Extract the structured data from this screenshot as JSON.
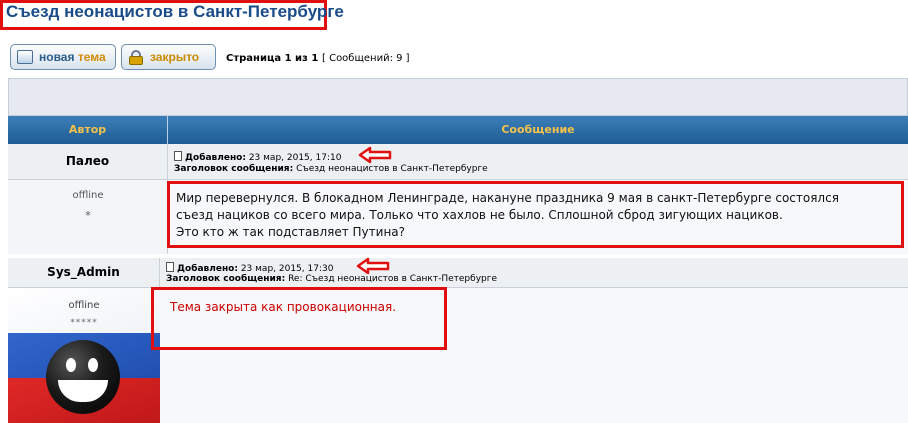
{
  "topic": {
    "title": "Съезд неонацистов в Санкт-Петербурге"
  },
  "toolbar": {
    "new_topic_part1": "новая",
    "new_topic_part2": "тема",
    "locked_label": "закрыто",
    "page_info": "Страница 1 из 1",
    "message_count": "[ Сообщений: 9 ]"
  },
  "table_header": {
    "author": "Автор",
    "message": "Сообщение"
  },
  "posts": [
    {
      "author": "Палео",
      "status": "offline",
      "rank": "*",
      "posted_label": "Добавлено:",
      "posted_date": "23 мар, 2015, 17:10",
      "subject_label": "Заголовок сообщения:",
      "subject": "Съезд неонацистов в Санкт-Петербурге",
      "text_lines": [
        "Мир перевернулся. В блокадном Ленинграде, накануне праздника 9 мая в санкт-Петербурге состоялся",
        "съезд нациков со всего мира. Только что хахлов не было. Сплошной сброд зигующих нациков.",
        "Это кто ж так подставляет Путина?"
      ]
    },
    {
      "author": "Sys_Admin",
      "status": "offline",
      "rank": "*****",
      "posted_label": "Добавлено:",
      "posted_date": "23 мар, 2015, 17:30",
      "subject_label": "Заголовок сообщения:",
      "subject": "Re: Съезд неонацистов в Санкт-Петербурге",
      "text": "Тема закрыта как провокационная."
    }
  ],
  "colors": {
    "highlight": "#e01010",
    "header_gradient_top": "#3c7fb8",
    "header_text": "#f5c24a",
    "moderator_text": "#cc0000"
  },
  "icons": [
    "new-topic-icon",
    "lock-icon",
    "post-icon",
    "arrow-left-icon"
  ]
}
